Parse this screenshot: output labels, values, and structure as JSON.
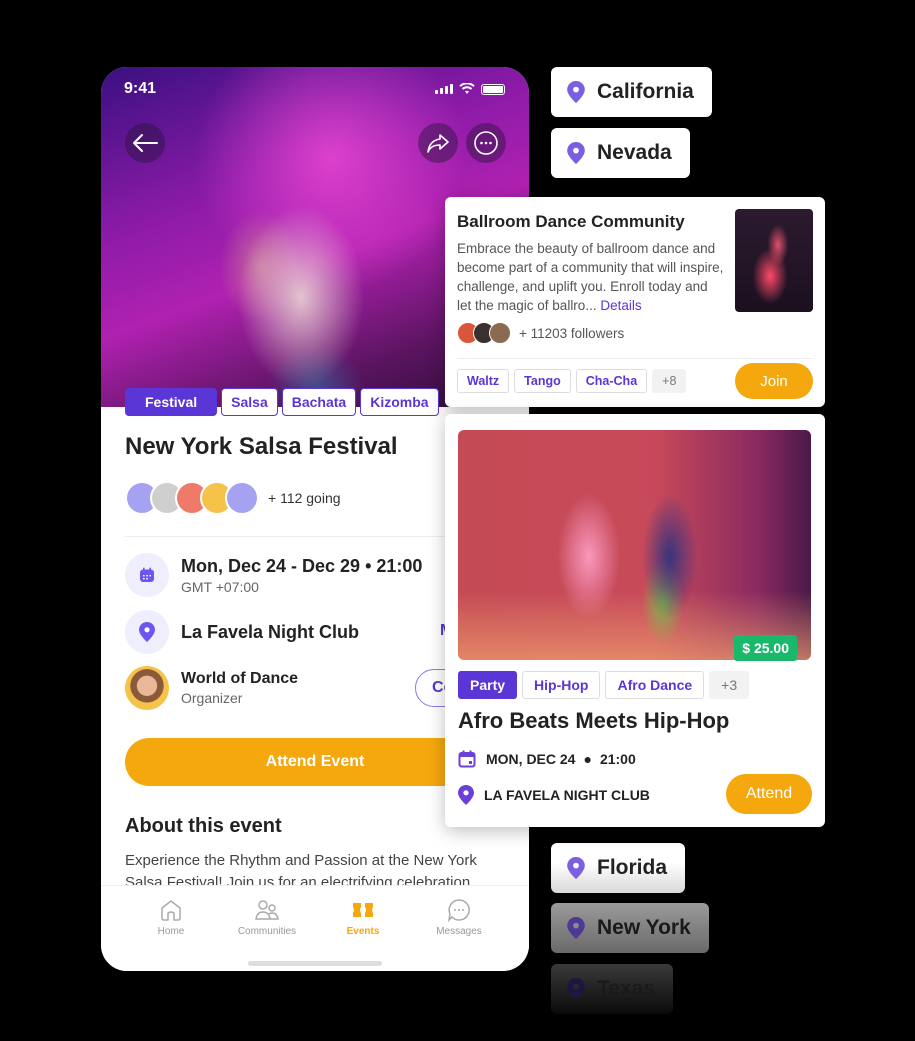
{
  "phone": {
    "status_bar": {
      "time": "9:41"
    },
    "hero": {
      "back_icon": "arrow-left-icon",
      "share_icon": "share-icon",
      "more_icon": "more-horizontal-icon"
    },
    "tags": [
      {
        "label": "Festival",
        "selected": true
      },
      {
        "label": "Salsa",
        "selected": false
      },
      {
        "label": "Bachata",
        "selected": false
      },
      {
        "label": "Kizomba",
        "selected": false
      }
    ],
    "title": "New York Salsa Festival",
    "going": {
      "text": "+ 112 going",
      "avatar_colors": [
        "#a6a2f2",
        "#cfcfcf",
        "#f07a6a",
        "#f5c24a",
        "#a6a2f2"
      ]
    },
    "date": {
      "main": "Mon, Dec 24 - Dec 29 • 21:00",
      "sub": "GMT +07:00"
    },
    "location": {
      "name": "La Favela Night Club",
      "link_partial": "M"
    },
    "organizer": {
      "name": "World of Dance",
      "role": "Organizer",
      "button_partial": "Co"
    },
    "attend_label": "Attend Event",
    "about": {
      "heading": "About this event",
      "text": "Experience the Rhythm and Passion at the New York Salsa Festival! Join us for an electrifying celebration"
    },
    "tabbar": [
      {
        "label": "Home",
        "icon": "home-icon",
        "active": false
      },
      {
        "label": "Communities",
        "icon": "users-icon",
        "active": false
      },
      {
        "label": "Events",
        "icon": "ticket-icon",
        "active": true
      },
      {
        "label": "Messages",
        "icon": "chat-icon",
        "active": false
      }
    ]
  },
  "locations": [
    "California",
    "Nevada",
    "Florida",
    "New York",
    "Texas"
  ],
  "community_card": {
    "title": "Ballroom Dance Community",
    "description": "Embrace the beauty of ballroom dance and become part of a community that will inspire, challenge, and uplift you. Enroll today and let the magic of ballro...",
    "details_link": "Details",
    "followers": "+ 11203 followers",
    "tags": [
      "Waltz",
      "Tango",
      "Cha-Cha"
    ],
    "more_tags": "+8",
    "join_label": "Join"
  },
  "event_card": {
    "price": "$ 25.00",
    "tags": [
      {
        "label": "Party",
        "selected": true
      },
      {
        "label": "Hip-Hop",
        "selected": false
      },
      {
        "label": "Afro Dance",
        "selected": false
      }
    ],
    "more_tags": "+3",
    "title": "Afro Beats Meets Hip-Hop",
    "date": "MON, DEC 24",
    "time": "21:00",
    "venue": "LA FAVELA NIGHT CLUB",
    "attend_label": "Attend"
  },
  "colors": {
    "primary": "#5b36d6",
    "accent": "#f5a80e",
    "price_green": "#19b86b"
  }
}
